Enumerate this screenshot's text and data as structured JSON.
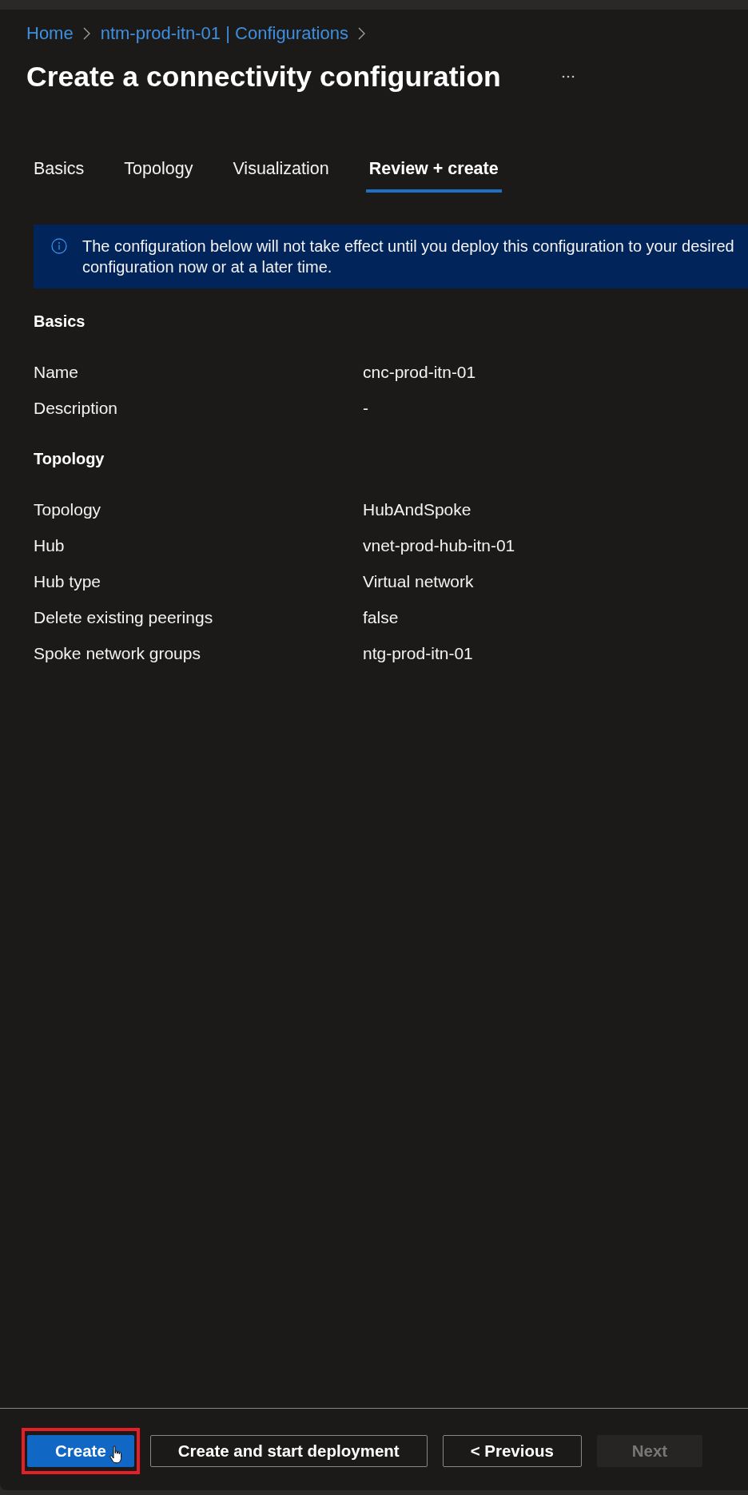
{
  "breadcrumb": [
    {
      "label": "Home"
    },
    {
      "label": "ntm-prod-itn-01 | Configurations"
    }
  ],
  "title": "Create a connectivity configuration",
  "tabs": [
    {
      "label": "Basics",
      "selected": false
    },
    {
      "label": "Topology",
      "selected": false
    },
    {
      "label": "Visualization",
      "selected": false
    },
    {
      "label": "Review + create",
      "selected": true
    }
  ],
  "notice": {
    "lines": [
      "The configuration below will not take effect until you deploy this configuration to your desired",
      "configuration now or at a later time."
    ]
  },
  "sections": [
    {
      "title": "Basics",
      "rows": [
        {
          "label": "Name",
          "value": "cnc-prod-itn-01"
        },
        {
          "label": "Description",
          "value": "-"
        }
      ]
    },
    {
      "title": "Topology",
      "rows": [
        {
          "label": "Topology",
          "value": "HubAndSpoke"
        },
        {
          "label": "Hub",
          "value": "vnet-prod-hub-itn-01"
        },
        {
          "label": "Hub type",
          "value": "Virtual network"
        },
        {
          "label": "Delete existing peerings",
          "value": "false"
        },
        {
          "label": "Spoke network groups",
          "value": "ntg-prod-itn-01"
        }
      ]
    }
  ],
  "buttons": [
    {
      "label": "Create",
      "kind": "primary",
      "disabled": false,
      "highlighted": true,
      "hovered": true
    },
    {
      "label": "Create and start deployment",
      "kind": "secondary",
      "disabled": false,
      "highlighted": false,
      "hovered": false
    },
    {
      "label": "< Previous",
      "kind": "secondary",
      "disabled": false,
      "highlighted": false,
      "hovered": false
    },
    {
      "label": "Next",
      "kind": "secondary",
      "disabled": true,
      "highlighted": false,
      "hovered": false
    }
  ]
}
